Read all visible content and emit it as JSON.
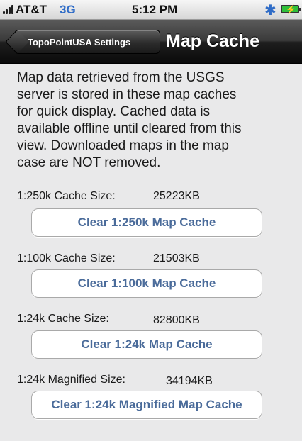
{
  "status_bar": {
    "carrier": "AT&T",
    "network": "3G",
    "time": "5:12 PM",
    "bluetooth_icon": "bluetooth-icon",
    "battery_icon": "battery-charging-icon"
  },
  "nav": {
    "back_label": "TopoPointUSA Settings",
    "title": "Map Cache"
  },
  "description": "Map data retrieved from the USGS\nserver is stored in these map caches\nfor quick display.  Cached data is\navailable offline until cleared from this\nview.  Downloaded maps in the map\ncase are NOT removed.",
  "caches": [
    {
      "label": "1:250k Cache Size:",
      "value": "25223KB",
      "button": "Clear 1:250k Map Cache"
    },
    {
      "label": "1:100k Cache Size:",
      "value": "21503KB",
      "button": "Clear 1:100k Map Cache"
    },
    {
      "label": "1:24k Cache Size:",
      "value": "82800KB",
      "button": "Clear 1:24k Map Cache"
    },
    {
      "label": "1:24k Magnified Size:",
      "value": "34194KB",
      "button": "Clear 1:24k Magnified Map Cache"
    }
  ],
  "colors": {
    "button_text": "#4a6b9a",
    "background": "#e9e9ea",
    "network_text": "#2f6cc7"
  }
}
